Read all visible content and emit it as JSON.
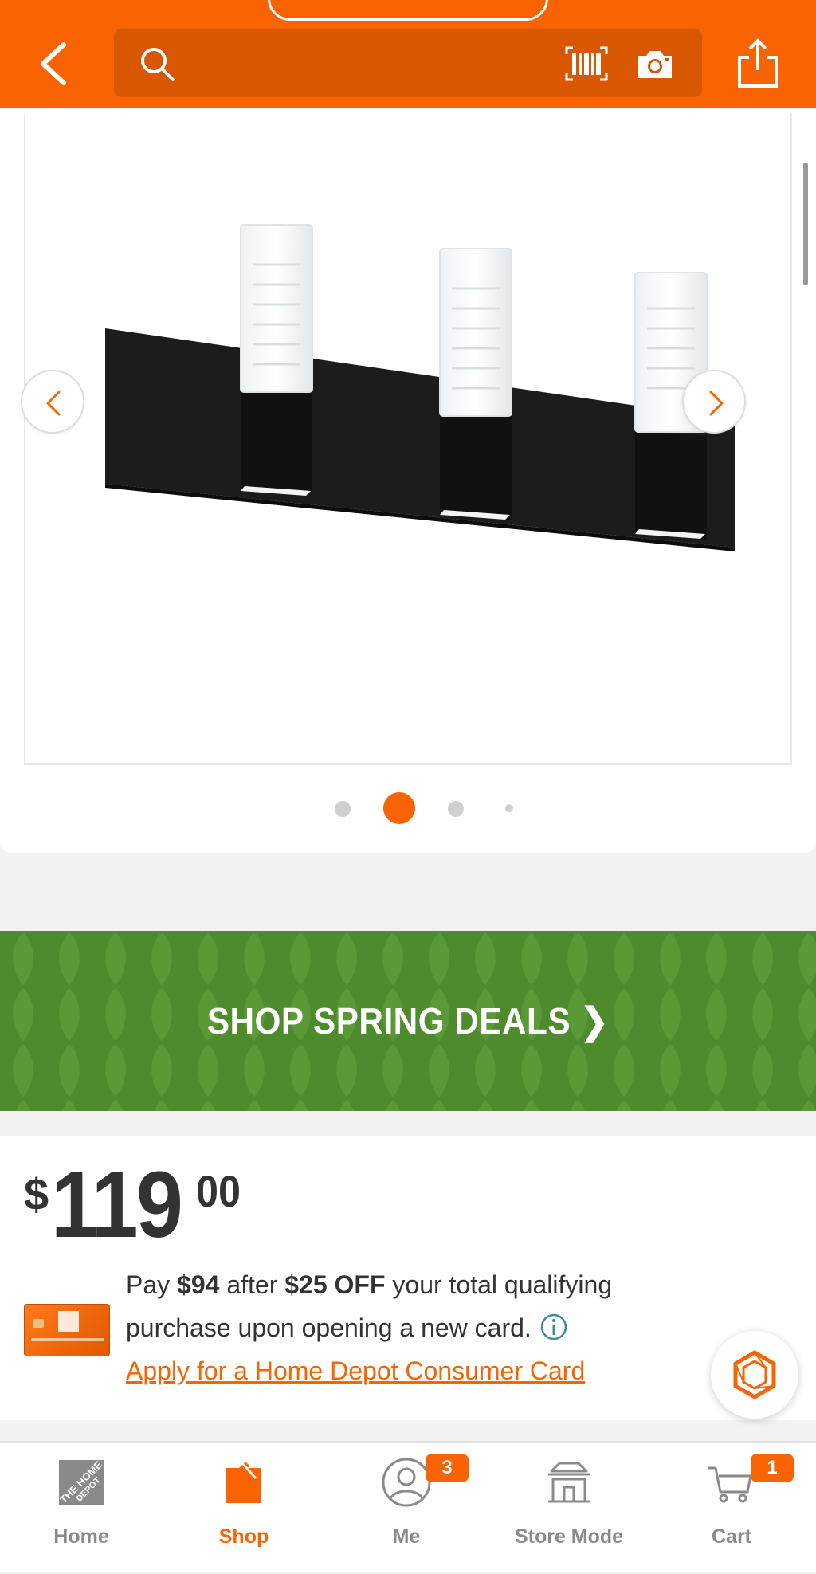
{
  "colors": {
    "brand": "#f96302",
    "brand_dark": "#d85700",
    "banner_green": "#4e8b2c",
    "text": "#333333",
    "muted": "#8a8a8a"
  },
  "header": {
    "back_icon": "chevron-left-icon",
    "search": {
      "placeholder": "",
      "icon": "search-icon"
    },
    "barcode_icon": "barcode-icon",
    "camera_icon": "camera-icon",
    "share_icon": "share-icon"
  },
  "gallery": {
    "image_alt": "Black 3-light bath vanity light fixture with clear glass shades",
    "dots_count": 4,
    "active_index": 1,
    "prev_icon": "chevron-left-icon",
    "next_icon": "chevron-right-icon"
  },
  "banner": {
    "label": "SHOP SPRING DEALS ❯"
  },
  "price": {
    "symbol": "$",
    "dollars": "119",
    "cents": "00"
  },
  "card_offer": {
    "pay_prefix": "Pay ",
    "pay_amount": "$94",
    "after_text": " after ",
    "discount": "$25 OFF",
    "line1_suffix": " your total qualifying",
    "line2": "purchase upon opening a new card.",
    "apply_link": "Apply for a Home Depot Consumer Card"
  },
  "bottom_nav": {
    "items": [
      {
        "label": "Home",
        "icon": "home-depot-logo-icon"
      },
      {
        "label": "Shop",
        "icon": "shop-icon",
        "active": true
      },
      {
        "label": "Me",
        "icon": "user-icon",
        "badge": "3"
      },
      {
        "label": "Store Mode",
        "icon": "store-icon"
      },
      {
        "label": "Cart",
        "icon": "cart-icon",
        "badge": "1"
      }
    ]
  }
}
